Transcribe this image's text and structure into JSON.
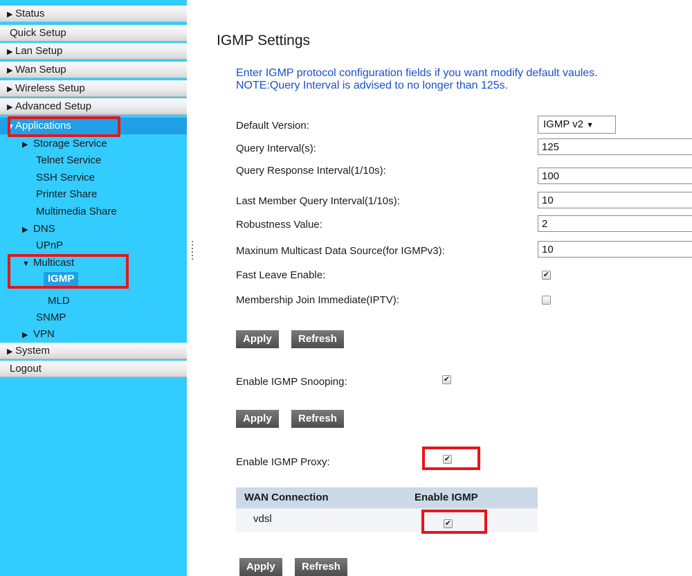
{
  "sidebar": {
    "top_items": [
      "Status",
      "Quick Setup",
      "Lan Setup",
      "Wan Setup",
      "Wireless Setup",
      "Advanced Setup"
    ],
    "applications_label": "Applications",
    "sub_items": {
      "storage": "Storage Service",
      "telnet": "Telnet Service",
      "ssh": "SSH Service",
      "printer": "Printer Share",
      "multimedia": "Multimedia Share",
      "dns": "DNS",
      "upnp": "UPnP",
      "multicast": "Multicast",
      "igmp": "IGMP",
      "mld": "MLD",
      "snmp": "SNMP",
      "vpn": "VPN"
    },
    "bottom_items": [
      "System",
      "Logout"
    ]
  },
  "main": {
    "title": "IGMP Settings",
    "note_line1": "Enter IGMP protocol configuration fields if you want modify default vaules.",
    "note_line2": "NOTE:Query Interval is advised to no longer than 125s.",
    "fields": {
      "default_version": {
        "label": "Default Version:",
        "value": "IGMP v2"
      },
      "query_interval": {
        "label": "Query Interval(s):",
        "value": "125"
      },
      "query_response": {
        "label": "Query Response Interval(1/10s):",
        "value": "100"
      },
      "last_member": {
        "label": "Last Member Query Interval(1/10s):",
        "value": "10"
      },
      "robustness": {
        "label": "Robustness Value:",
        "value": "2"
      },
      "max_source": {
        "label": "Maxinum Multicast Data Source(for IGMPv3):",
        "value": "10"
      },
      "fast_leave": {
        "label": "Fast Leave Enable:",
        "checked": true
      },
      "join_immediate": {
        "label": "Membership Join Immediate(IPTV):",
        "checked": false
      }
    },
    "snooping": {
      "label": "Enable IGMP Snooping:",
      "checked": true
    },
    "proxy": {
      "label": "Enable IGMP Proxy:",
      "checked": true
    },
    "table": {
      "headers": [
        "WAN Connection",
        "Enable IGMP"
      ],
      "rows": [
        {
          "wan": "vdsl",
          "enable": true
        }
      ]
    },
    "buttons": {
      "apply": "Apply",
      "refresh": "Refresh"
    }
  },
  "glyphs": {
    "collapsed": "▶",
    "expanded": "▼",
    "check": "✔"
  },
  "colors": {
    "sidebar_bg": "#33ccff",
    "active_bg": "#1f9fe6",
    "highlight_box": "#e8151b",
    "note_text": "#1850c8"
  }
}
